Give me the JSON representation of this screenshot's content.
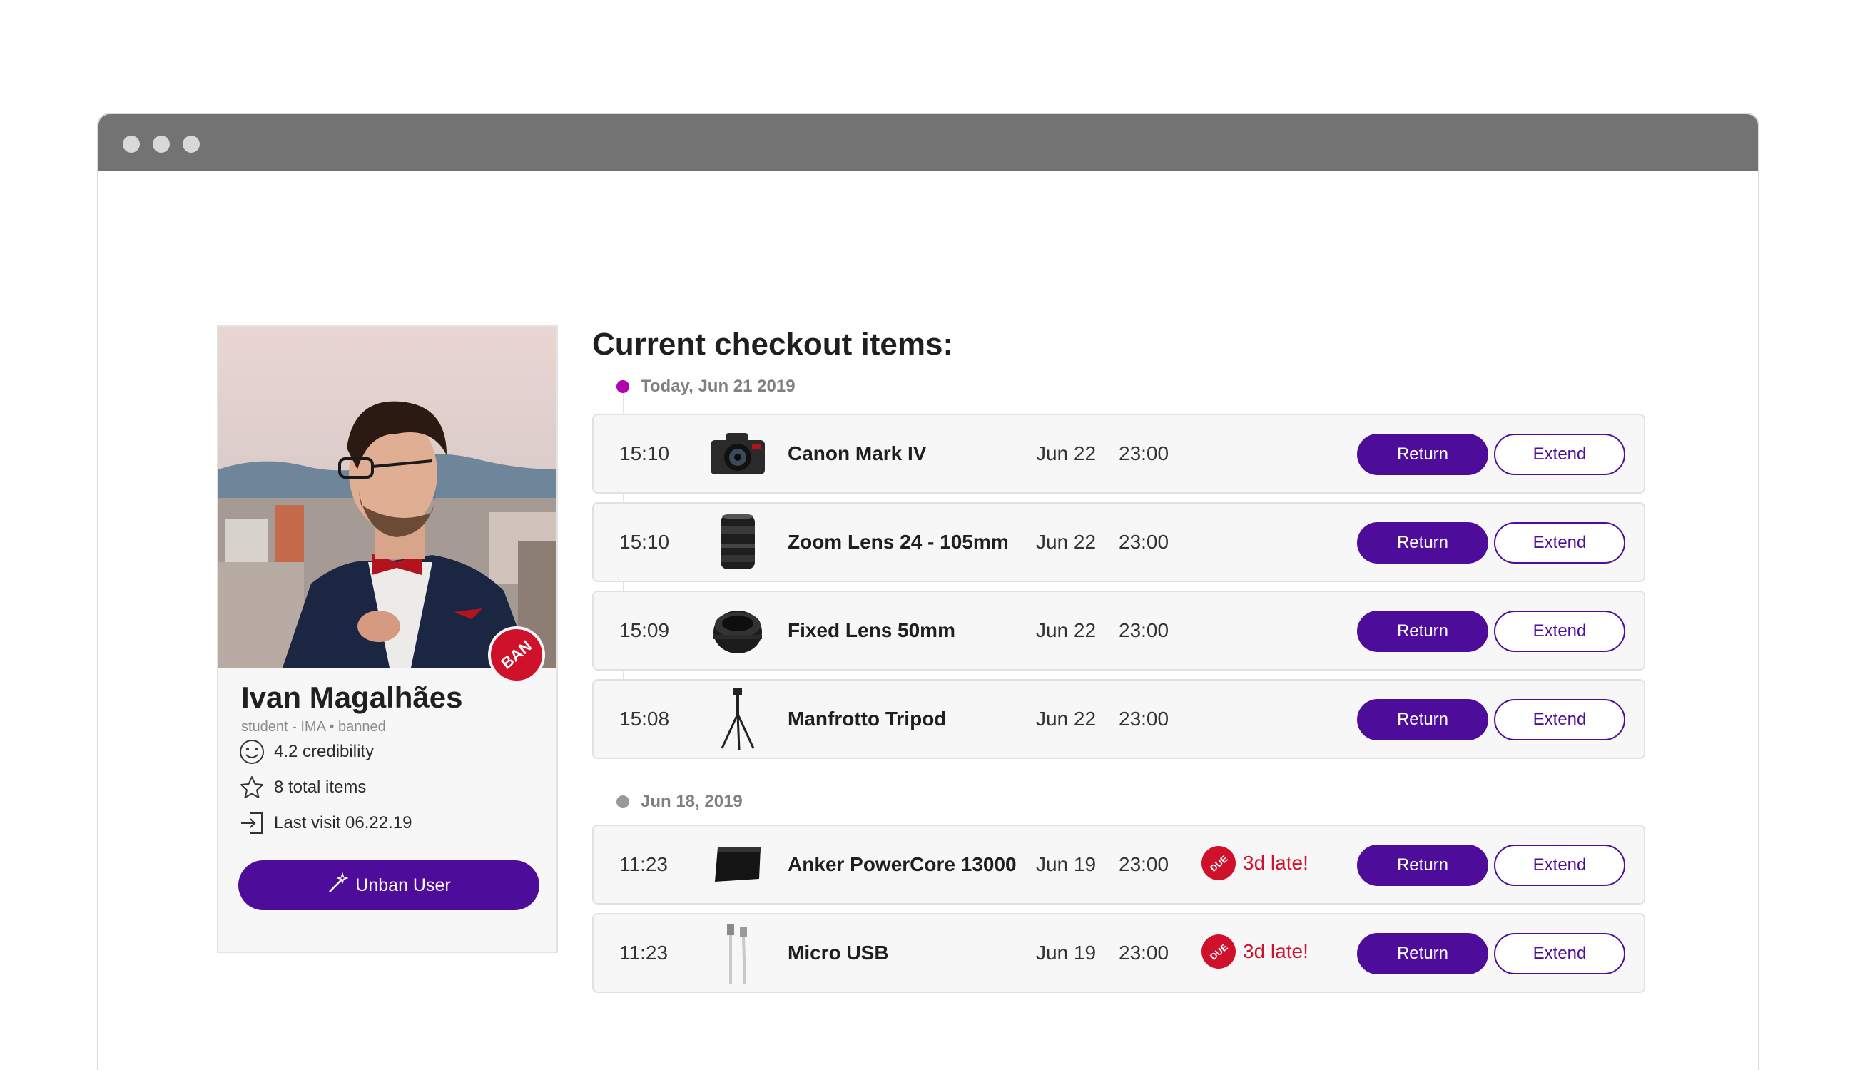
{
  "profile": {
    "name": "Ivan Magalhães",
    "role": "student - IMA",
    "status": "banned",
    "badge": "BAN",
    "badge_color": "#d0112b",
    "credibility": "4.2 credibility",
    "total_items": "8 total items",
    "last_visit": "Last visit 06.22.19",
    "unban_label": "Unban User",
    "icons": {
      "credibility": "smiley-icon",
      "items": "star-icon",
      "visit": "login-arrow-icon",
      "unban": "magic-wand-icon"
    }
  },
  "checkout": {
    "title": "Current checkout items:",
    "groups": [
      {
        "date": "Today, Jun 21 2019",
        "dot_color": "#b000b0",
        "items": [
          {
            "time": "15:10",
            "name": "Canon Mark IV",
            "due_date": "Jun 22",
            "due_time": "23:00",
            "icon": "camera-icon"
          },
          {
            "time": "15:10",
            "name": "Zoom Lens 24 - 105mm",
            "due_date": "Jun 22",
            "due_time": "23:00",
            "icon": "zoom-lens-icon"
          },
          {
            "time": "15:09",
            "name": "Fixed Lens 50mm",
            "due_date": "Jun 22",
            "due_time": "23:00",
            "icon": "fixed-lens-icon"
          },
          {
            "time": "15:08",
            "name": "Manfrotto Tripod",
            "due_date": "Jun 22",
            "due_time": "23:00",
            "icon": "tripod-icon"
          }
        ]
      },
      {
        "date": "Jun 18, 2019",
        "dot_color": "#999999",
        "items": [
          {
            "time": "11:23",
            "name": "Anker PowerCore 13000",
            "due_date": "Jun 19",
            "due_time": "23:00",
            "late_badge": "DUE",
            "late": "3d late!",
            "icon": "power-bank-icon"
          },
          {
            "time": "11:23",
            "name": "Micro USB",
            "due_date": "Jun 19",
            "due_time": "23:00",
            "late_badge": "DUE",
            "late": "3d late!",
            "icon": "usb-cable-icon"
          }
        ]
      }
    ],
    "return_label": "Return",
    "extend_label": "Extend"
  },
  "colors": {
    "accent": "#4d0c99",
    "danger": "#d0112b",
    "titlebar": "#737373"
  }
}
